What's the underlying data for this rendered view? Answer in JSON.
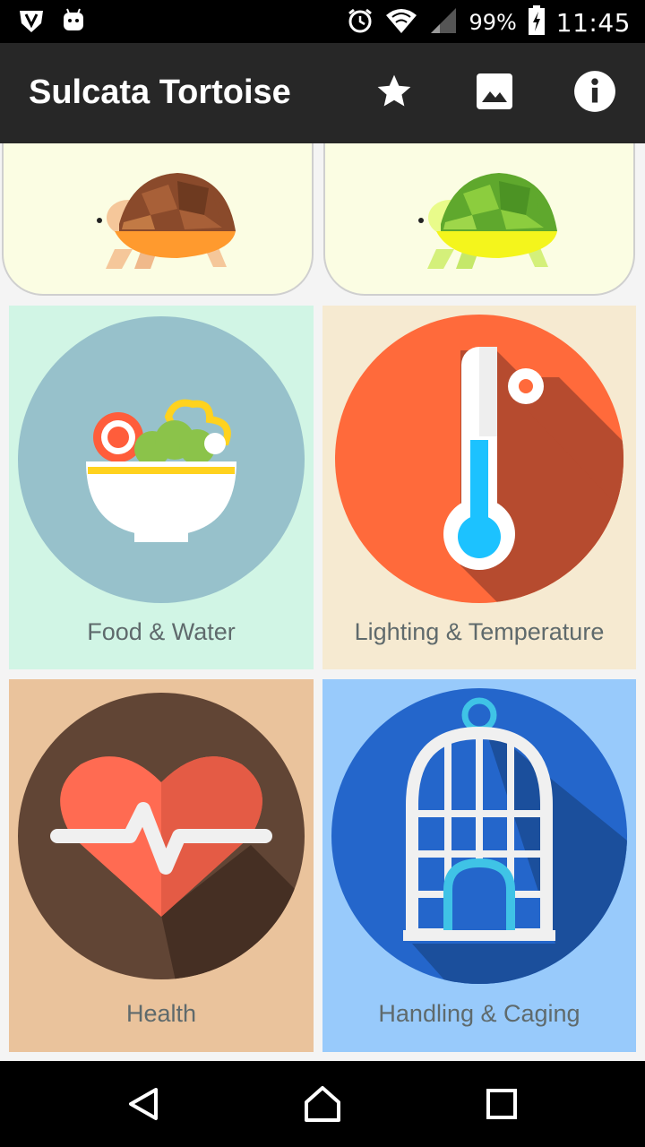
{
  "status_bar": {
    "battery_percent": "99%",
    "time": "11:45",
    "icons": [
      "shield-icon",
      "android-icon",
      "alarm-icon",
      "wifi-icon",
      "signal-icon",
      "battery-charging-icon"
    ]
  },
  "app_bar": {
    "title": "Sulcata Tortoise",
    "actions": [
      "star-icon",
      "image-icon",
      "info-icon"
    ]
  },
  "top_cards": [
    {
      "icon": "brown-tortoise-icon"
    },
    {
      "icon": "green-tortoise-icon"
    }
  ],
  "tiles": [
    {
      "label": "Food & Water",
      "icon": "food-bowl-icon",
      "bg": "#d1f5e5",
      "circle": "#97c1cb"
    },
    {
      "label": "Lighting & Temperature",
      "icon": "thermometer-icon",
      "bg": "#f6ead1",
      "circle": "#ff6a3b"
    },
    {
      "label": "Health",
      "icon": "heart-pulse-icon",
      "bg": "#eac39c",
      "circle": "#614535"
    },
    {
      "label": "Handling & Caging",
      "icon": "cage-icon",
      "bg": "#98cafb",
      "circle": "#2466cb"
    }
  ],
  "nav_bar": {
    "buttons": [
      "back-icon",
      "home-icon",
      "recents-icon"
    ]
  },
  "colors": {
    "status_bar": "#000000",
    "app_bar": "#272727",
    "top_card_bg": "#fbfde3"
  }
}
